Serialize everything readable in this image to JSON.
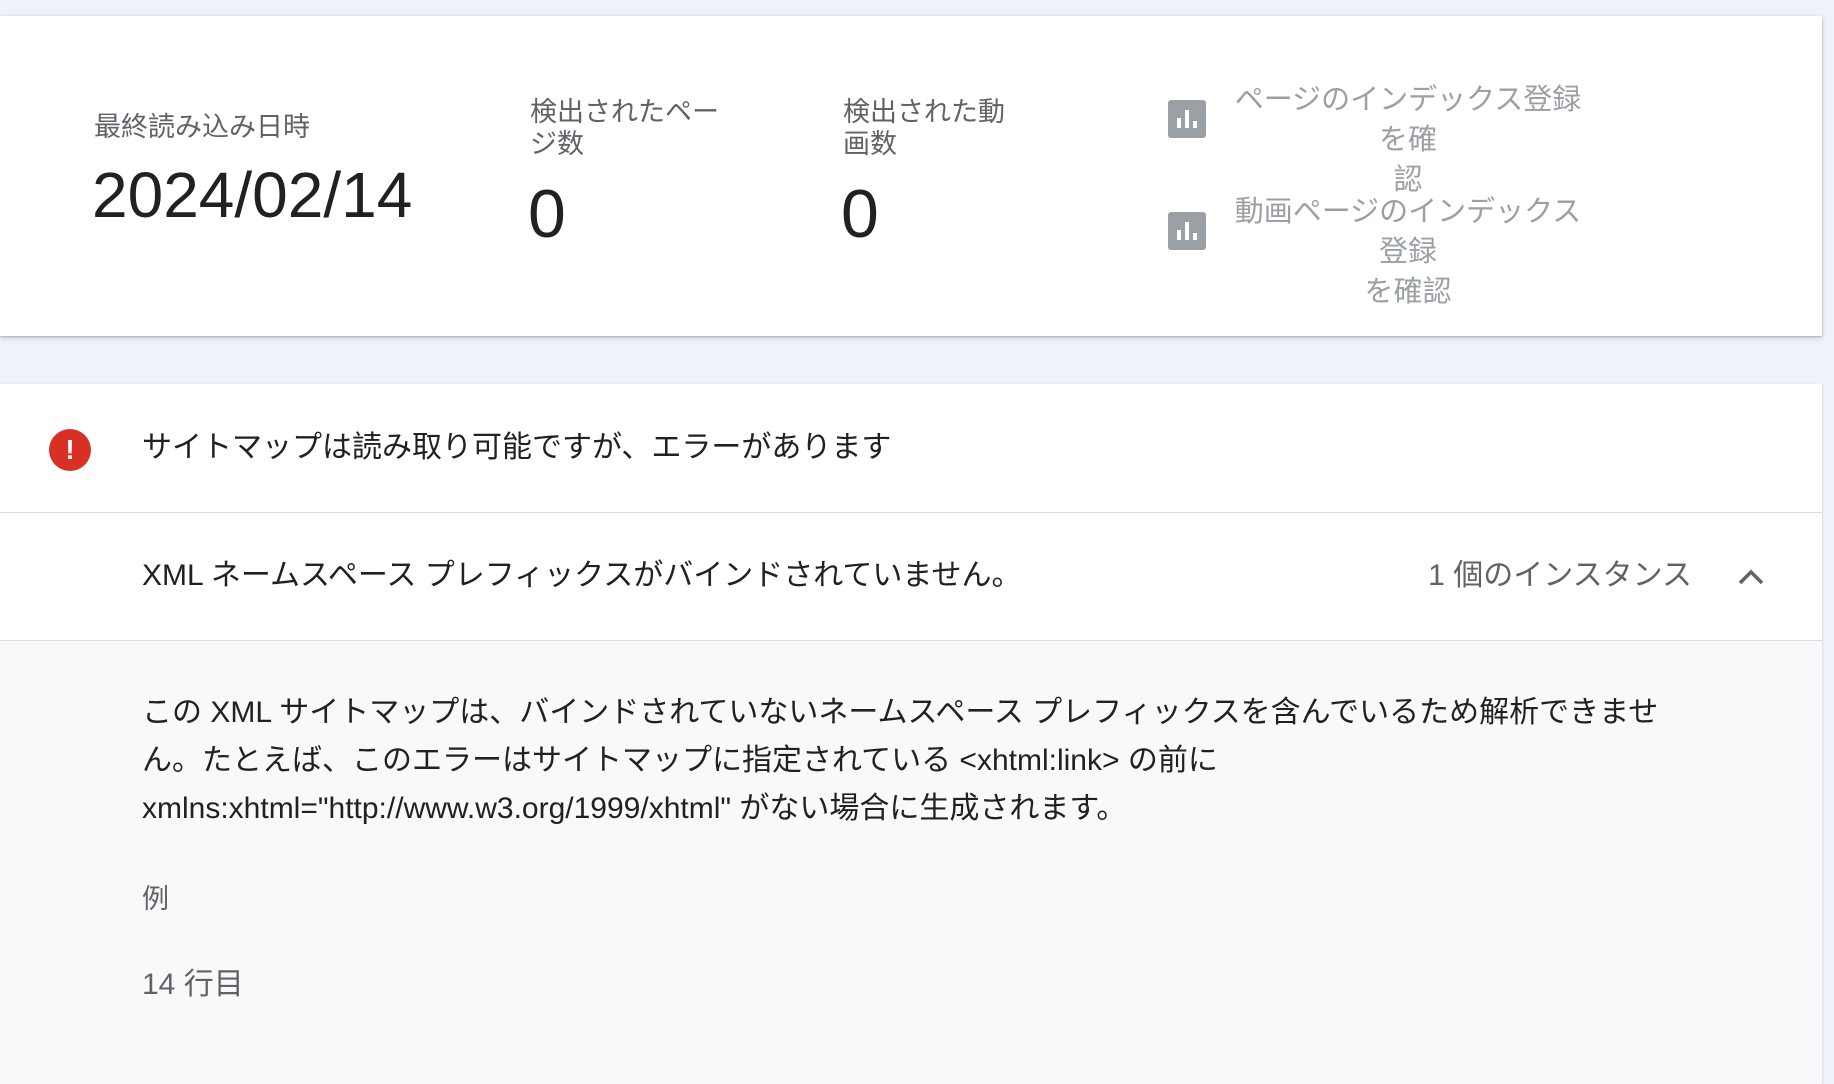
{
  "summary": {
    "last_read_label": "最終読み込み日時",
    "last_read_value": "2024/02/14",
    "pages_label_line1": "検出されたペー",
    "pages_label_line2": "ジ数",
    "pages_value": "0",
    "videos_label_line1": "検出された動",
    "videos_label_line2": "画数",
    "videos_value": "0",
    "links": [
      {
        "icon": "bar-chart-icon",
        "line1": "ページのインデックス登録を確",
        "line2": "認"
      },
      {
        "icon": "bar-chart-icon",
        "line1": "動画ページのインデックス登録",
        "line2": "を確認"
      }
    ]
  },
  "status": {
    "icon": "error-icon",
    "icon_glyph": "!",
    "text": "サイトマップは読み取り可能ですが、エラーがあります",
    "color": "#d93025"
  },
  "issue": {
    "title": "XML ネームスペース プレフィックスがバインドされていません。",
    "count": "1 個のインスタンス",
    "expand_icon": "chevron-up-icon"
  },
  "detail": {
    "line1": "この XML サイトマップは、バインドされていないネームスペース プレフィックスを含んでいるため解析できませ",
    "line2": "ん。たとえば、このエラーはサイトマップに指定されている <xhtml:link> の前に",
    "line3": "xmlns:xhtml=\"http://www.w3.org/1999/xhtml\" がない場合に生成されます。",
    "example_label": "例",
    "line_label": "14 行目"
  }
}
